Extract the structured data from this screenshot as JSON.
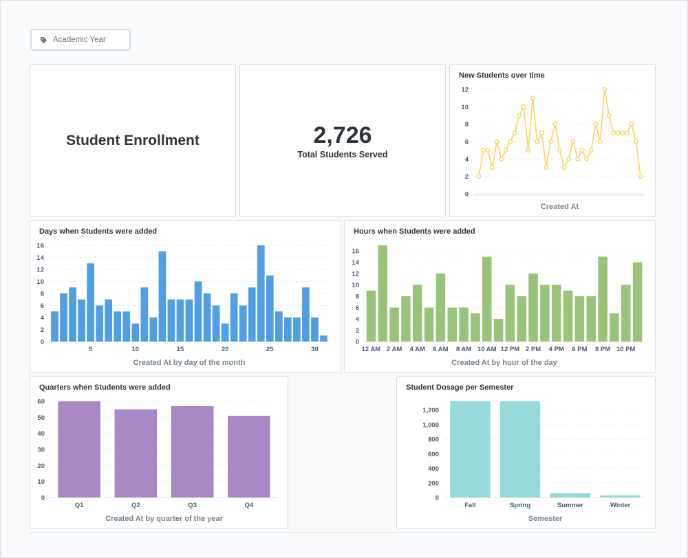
{
  "filter": {
    "label": "Academic Year",
    "icon": "tag-icon"
  },
  "cards": {
    "heading": {
      "text": "Student Enrollment"
    },
    "scalar": {
      "value": "2,726",
      "label": "Total Students Served"
    }
  },
  "charts": [
    {
      "key": "new_students",
      "title": "New Students over time",
      "type": "line",
      "color": "#f9d45c",
      "xlabel": "Created At",
      "yticks": [
        0,
        2,
        4,
        6,
        8,
        10,
        12
      ],
      "ylim": [
        0,
        12
      ],
      "values": [
        2,
        5,
        5,
        3,
        6,
        4,
        5,
        6,
        7,
        9,
        10,
        5,
        11,
        6,
        7,
        3,
        6,
        8,
        5,
        3,
        4,
        6,
        4,
        5,
        4,
        5,
        8,
        6,
        12,
        9,
        7,
        7,
        7,
        7,
        8,
        6,
        2
      ]
    },
    {
      "key": "days",
      "title": "Days when Students were added",
      "type": "bar",
      "color": "#509ee3",
      "xlabel": "Created At by day of the month",
      "categories": [
        1,
        2,
        3,
        4,
        5,
        6,
        7,
        8,
        9,
        10,
        11,
        12,
        13,
        14,
        15,
        16,
        17,
        18,
        19,
        20,
        21,
        22,
        23,
        24,
        25,
        26,
        27,
        28,
        29,
        30,
        31
      ],
      "xticks": [
        "5",
        "10",
        "15",
        "20",
        "25",
        "30"
      ],
      "xtick_positions": [
        5,
        10,
        15,
        20,
        25,
        30
      ],
      "yticks": [
        0,
        2,
        4,
        6,
        8,
        10,
        12,
        14,
        16
      ],
      "ylim": [
        0,
        16
      ],
      "values": [
        5,
        8,
        9,
        7,
        13,
        6,
        7,
        5,
        5,
        3,
        9,
        4,
        15,
        7,
        7,
        7,
        10,
        8,
        6,
        3,
        8,
        6,
        9,
        16,
        11,
        5,
        4,
        4,
        9,
        4,
        1
      ]
    },
    {
      "key": "hours",
      "title": "Hours when Students were added",
      "type": "bar",
      "color": "#98c379",
      "xlabel": "Created At by hour of the day",
      "categories": [
        "12 AM",
        "1 AM",
        "2 AM",
        "3 AM",
        "4 AM",
        "5 AM",
        "6 AM",
        "7 AM",
        "8 AM",
        "9 AM",
        "10 AM",
        "11 AM",
        "12 PM",
        "1 PM",
        "2 PM",
        "3 PM",
        "4 PM",
        "5 PM",
        "6 PM",
        "7 PM",
        "8 PM",
        "9 PM",
        "10 PM",
        "11 PM"
      ],
      "xticks": [
        "12 AM",
        "2 AM",
        "4 AM",
        "6 AM",
        "8 AM",
        "10 AM",
        "12 PM",
        "2 PM",
        "4 PM",
        "6 PM",
        "8 PM",
        "10 PM"
      ],
      "xtick_positions": [
        0,
        2,
        4,
        6,
        8,
        10,
        12,
        14,
        16,
        18,
        20,
        22
      ],
      "yticks": [
        0,
        2,
        4,
        6,
        8,
        10,
        12,
        14,
        16
      ],
      "ylim": [
        0,
        17
      ],
      "values": [
        9,
        17,
        6,
        8,
        10,
        6,
        12,
        6,
        6,
        5,
        15,
        4,
        10,
        8,
        12,
        10,
        10,
        9,
        8,
        8,
        15,
        5,
        10,
        14
      ]
    },
    {
      "key": "quarters",
      "title": "Quarters when Students were added",
      "type": "bar",
      "color": "#a989c5",
      "xlabel": "Created At by quarter of the year",
      "categories": [
        "Q1",
        "Q2",
        "Q3",
        "Q4"
      ],
      "xticks": [
        "Q1",
        "Q2",
        "Q3",
        "Q4"
      ],
      "xtick_positions": [
        0,
        1,
        2,
        3
      ],
      "yticks": [
        0,
        10,
        20,
        30,
        40,
        50,
        60
      ],
      "ylim": [
        0,
        60
      ],
      "values": [
        60,
        55,
        57,
        51
      ]
    },
    {
      "key": "dosage",
      "title": "Student Dosage per Semester",
      "type": "bar",
      "color": "#98d9d9",
      "xlabel": "Semester",
      "categories": [
        "Fall",
        "Spring",
        "Summer",
        "Winter"
      ],
      "xticks": [
        "Fall",
        "Spring",
        "Summer",
        "Winter"
      ],
      "xtick_positions": [
        0,
        1,
        2,
        3
      ],
      "yticks": [
        "0",
        "200",
        "400",
        "600",
        "800",
        "1,000",
        "1,200"
      ],
      "ytick_values": [
        0,
        200,
        400,
        600,
        800,
        1000,
        1200
      ],
      "ylim": [
        0,
        1320
      ],
      "values": [
        1320,
        1320,
        60,
        30
      ]
    }
  ],
  "chart_data": [
    {
      "type": "line",
      "title": "New Students over time",
      "xlabel": "Created At",
      "ylabel": "",
      "ylim": [
        0,
        12
      ],
      "series": [
        {
          "values": [
            2,
            5,
            5,
            3,
            6,
            4,
            5,
            6,
            7,
            9,
            10,
            5,
            11,
            6,
            7,
            3,
            6,
            8,
            5,
            3,
            4,
            6,
            4,
            5,
            4,
            5,
            8,
            6,
            12,
            9,
            7,
            7,
            7,
            7,
            8,
            6,
            2
          ]
        }
      ]
    },
    {
      "type": "bar",
      "title": "Days when Students were added",
      "xlabel": "Created At by day of the month",
      "categories": [
        1,
        2,
        3,
        4,
        5,
        6,
        7,
        8,
        9,
        10,
        11,
        12,
        13,
        14,
        15,
        16,
        17,
        18,
        19,
        20,
        21,
        22,
        23,
        24,
        25,
        26,
        27,
        28,
        29,
        30,
        31
      ],
      "values": [
        5,
        8,
        9,
        7,
        13,
        6,
        7,
        5,
        5,
        3,
        9,
        4,
        15,
        7,
        7,
        7,
        10,
        8,
        6,
        3,
        8,
        6,
        9,
        16,
        11,
        5,
        4,
        4,
        9,
        4,
        1
      ],
      "ylim": [
        0,
        16
      ]
    },
    {
      "type": "bar",
      "title": "Hours when Students were added",
      "xlabel": "Created At by hour of the day",
      "categories": [
        "12 AM",
        "1 AM",
        "2 AM",
        "3 AM",
        "4 AM",
        "5 AM",
        "6 AM",
        "7 AM",
        "8 AM",
        "9 AM",
        "10 AM",
        "11 AM",
        "12 PM",
        "1 PM",
        "2 PM",
        "3 PM",
        "4 PM",
        "5 PM",
        "6 PM",
        "7 PM",
        "8 PM",
        "9 PM",
        "10 PM",
        "11 PM"
      ],
      "values": [
        9,
        17,
        6,
        8,
        10,
        6,
        12,
        6,
        6,
        5,
        15,
        4,
        10,
        8,
        12,
        10,
        10,
        9,
        8,
        8,
        15,
        5,
        10,
        14
      ],
      "ylim": [
        0,
        17
      ]
    },
    {
      "type": "bar",
      "title": "Quarters when Students were added",
      "xlabel": "Created At by quarter of the year",
      "categories": [
        "Q1",
        "Q2",
        "Q3",
        "Q4"
      ],
      "values": [
        60,
        55,
        57,
        51
      ],
      "ylim": [
        0,
        60
      ]
    },
    {
      "type": "bar",
      "title": "Student Dosage per Semester",
      "xlabel": "Semester",
      "categories": [
        "Fall",
        "Spring",
        "Summer",
        "Winter"
      ],
      "values": [
        1320,
        1320,
        60,
        30
      ],
      "ylim": [
        0,
        1320
      ]
    }
  ]
}
